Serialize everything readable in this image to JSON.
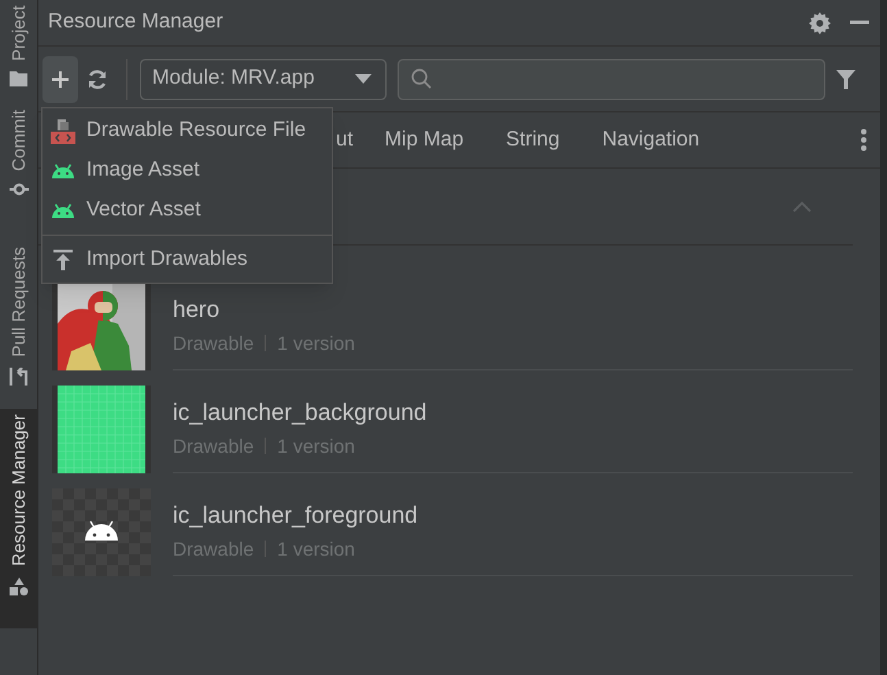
{
  "window": {
    "title": "Resource Manager"
  },
  "side_tabs": [
    {
      "label": "Project",
      "selected": false
    },
    {
      "label": "Commit",
      "selected": false
    },
    {
      "label": "Pull Requests",
      "selected": false
    },
    {
      "label": "Resource Manager",
      "selected": true
    }
  ],
  "toolbar": {
    "module": "Module: MRV.app"
  },
  "tabs": [
    {
      "label": "ut"
    },
    {
      "label": "Mip Map"
    },
    {
      "label": "String"
    },
    {
      "label": "Navigation"
    }
  ],
  "add_menu": {
    "groups": [
      [
        {
          "label": "Drawable Resource File",
          "kind": "file"
        },
        {
          "label": "Image Asset",
          "kind": "android"
        },
        {
          "label": "Vector Asset",
          "kind": "android"
        }
      ],
      [
        {
          "label": "Import Drawables",
          "kind": "import"
        }
      ]
    ]
  },
  "resources": [
    {
      "name": "hero",
      "type": "Drawable",
      "versions": "1 version",
      "kind": "picture"
    },
    {
      "name": "ic_launcher_background",
      "type": "Drawable",
      "versions": "1 version",
      "kind": "grid"
    },
    {
      "name": "ic_launcher_foreground",
      "type": "Drawable",
      "versions": "1 version",
      "kind": "android"
    }
  ]
}
